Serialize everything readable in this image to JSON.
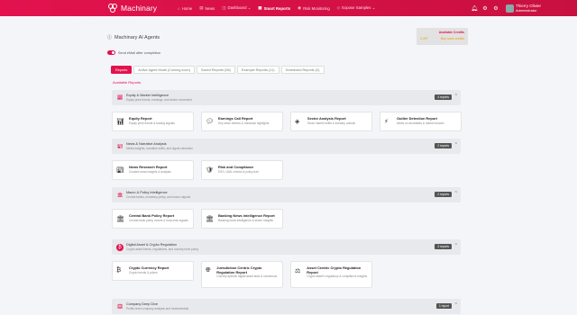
{
  "app": {
    "name": "Machinary"
  },
  "nav": [
    {
      "icon": "⌂",
      "label": "Home",
      "active": false
    },
    {
      "icon": "▤",
      "label": "News",
      "active": false
    },
    {
      "icon": "◫",
      "label": "Dashboard ⌄",
      "active": false
    },
    {
      "icon": "▦",
      "label": "Smart Reports",
      "active": true
    },
    {
      "icon": "◉",
      "label": "Risk Monitoring",
      "active": false
    },
    {
      "icon": "◇",
      "label": "Expose Samples ⌄",
      "active": false
    }
  ],
  "user": {
    "name": "Thierry Olivier",
    "role": "Administrator"
  },
  "page_title": "Machinary AI Agents",
  "credits": {
    "title": "Available Credits",
    "left": "2,497",
    "right": "Buy more credits"
  },
  "toggle_label": "Send eMail after completion",
  "tabs": [
    {
      "label": "Reports",
      "active": true
    },
    {
      "label": "Active Agent Mode (Coming soon)",
      "active": false
    },
    {
      "label": "Saved Reports (56)",
      "active": false
    },
    {
      "label": "Example Reports (11)",
      "active": false
    },
    {
      "label": "Scheduled Reports (0)",
      "active": false
    }
  ],
  "available_label": "Available Reports",
  "sections": [
    {
      "title": "Equity & Market Intelligence",
      "desc": "Equity price trends, earnings, and sector movement",
      "count": "4 reports",
      "icon": "chart-line-icon",
      "cards": [
        {
          "title": "Equity Report",
          "desc": "Equity price trends & trading signals",
          "icon": "chart-icon"
        },
        {
          "title": "Earnings Call Report",
          "desc": "Key stock metrics & transcript highlights",
          "icon": "chat-icon"
        },
        {
          "title": "Sector Analysis Report",
          "desc": "Stock market shifts & industry outlook",
          "icon": "layers-icon"
        },
        {
          "title": "Outlier Detection Report",
          "desc": "Alerts on anomalies & market shocks",
          "icon": "bolt-icon"
        }
      ]
    },
    {
      "title": "News & Narrative Analysis",
      "desc": "Media insights, narrative shifts, and signal extraction",
      "count": "2 reports",
      "icon": "newspaper-icon",
      "cards": [
        {
          "title": "News Research Report",
          "desc": "Curated news insights & analysis",
          "icon": "newspaper-icon"
        },
        {
          "title": "Risk and Compliance",
          "desc": "ESG / AML checks & policy trail",
          "icon": "shield-icon"
        }
      ]
    },
    {
      "title": "Macro & Policy Intelligence",
      "desc": "Central banks, monetary policy, and macro signals",
      "count": "2 reports",
      "icon": "bank-icon",
      "cards": [
        {
          "title": "Central Bank Policy Report",
          "desc": "Central bank policy moves & economic signals",
          "icon": "bank-icon"
        },
        {
          "title": "Banking News Intelligence Report",
          "desc": "Banking news intelligence & sector insights",
          "icon": "bank-icon"
        }
      ]
    },
    {
      "title": "Digital Asset & Crypto Regulation",
      "desc": "Crypto asset trends, regulations, and country-level policy",
      "count": "3 reports",
      "icon": "bitcoin-icon",
      "cards": [
        {
          "title": "Crypto Currency Report",
          "desc": "Crypto trends & prices",
          "icon": "bitcoin-icon"
        },
        {
          "title": "Jurisdiction Centric Crypto Regulation Report",
          "desc": "Country-specific digital asset laws & consensus",
          "icon": "globe-icon"
        },
        {
          "title": "Asset Centric Crypto Regulation Report",
          "desc": "Crypto asset's regulatory & compliance insights",
          "icon": "scale-icon"
        }
      ]
    },
    {
      "title": "Company Deep Dive",
      "desc": "Profile-level company analysis and fundamentals",
      "count": "1 report",
      "icon": "building-icon",
      "cards": []
    }
  ]
}
